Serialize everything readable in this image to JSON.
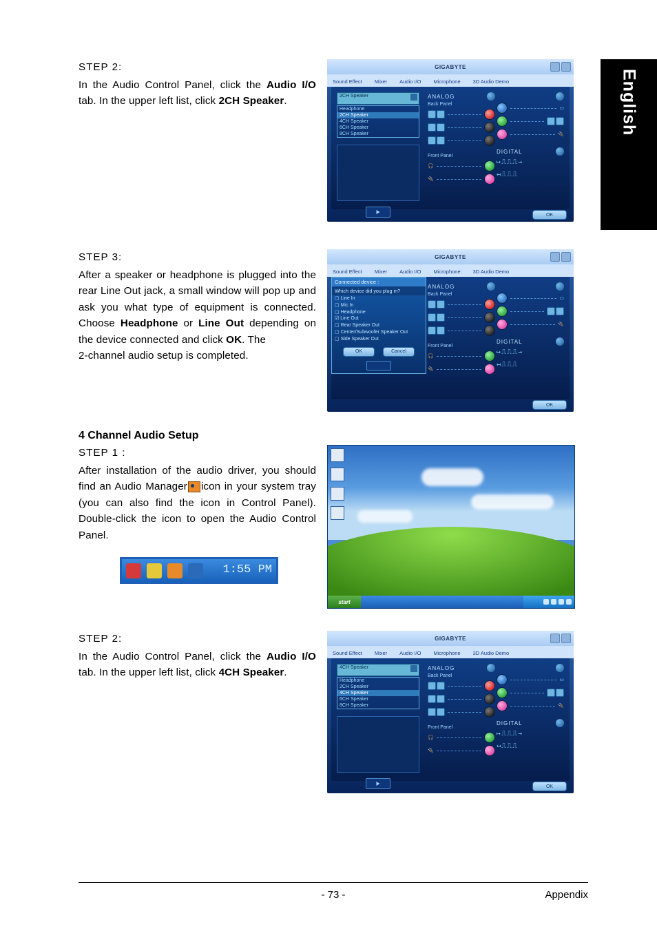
{
  "language_tab": "English",
  "section1": {
    "step_label": "STEP 2:",
    "line1a": "In the Audio Control Panel, click the ",
    "bold1": "Audio I/O",
    "line1b": " tab. In the upper left list, click ",
    "bold2": "2CH Speaker",
    "line1c": "."
  },
  "section2": {
    "step_label": "STEP 3:",
    "l1": "After a speaker or headphone is plugged into the rear Line Out jack, a small window will pop up and ask you what type of equipment is connected. Choose ",
    "b1": "Headphone",
    "l2": " or ",
    "b2": "Line Out",
    "l3": " depending on the device connected and click ",
    "b3": "OK",
    "l4": ". The",
    "l5": "2-channel audio setup is completed."
  },
  "heading4ch": "4 Channel Audio Setup",
  "section3": {
    "step_label": "STEP 1 :",
    "l1": "After installation of the audio driver, you should find an Audio Manager",
    "l2": "icon in your system tray (you can also find the icon in Control Panel). Double-click the icon to open the Audio Control Panel."
  },
  "section4": {
    "step_label": "STEP 2:",
    "line1a": "In the Audio Control Panel, click the ",
    "bold1": "Audio I/O",
    "line1b": " tab. In the upper left list, click ",
    "bold2": "4CH Speaker",
    "line1c": "."
  },
  "panel": {
    "brand": "GIGABYTE",
    "tabs": [
      "Sound Effect",
      "Mixer",
      "Audio I/O",
      "Microphone",
      "3D Audio Demo"
    ],
    "dropdown_2ch": "2CH Speaker",
    "dropdown_4ch": "4CH Speaker",
    "speaker_list_2": [
      "Headphone",
      "2CH Speaker",
      "4CH Speaker",
      "6CH Speaker",
      "8CH Speaker"
    ],
    "speaker_list_4": [
      "Headphone",
      "2CH Speaker",
      "4CH Speaker",
      "6CH Speaker",
      "8CH Speaker"
    ],
    "analog": "ANALOG",
    "back_panel": "Back Panel",
    "front_panel": "Front Panel",
    "digital": "DIGITAL",
    "ok": "OK"
  },
  "popup": {
    "title": "Connected device :",
    "question": "Which device did you plug in?",
    "options": [
      "Line In",
      "Mic In",
      "Headphone",
      "Line Out",
      "Rear Speaker Out",
      "Center/Subwoofer Speaker Out",
      "Side Speaker Out"
    ],
    "ok": "OK",
    "cancel": "Cancel"
  },
  "systray": {
    "time": "1:55 PM"
  },
  "desktop": {
    "start": "start"
  },
  "footer": {
    "page": "- 73 -",
    "section": "Appendix"
  }
}
